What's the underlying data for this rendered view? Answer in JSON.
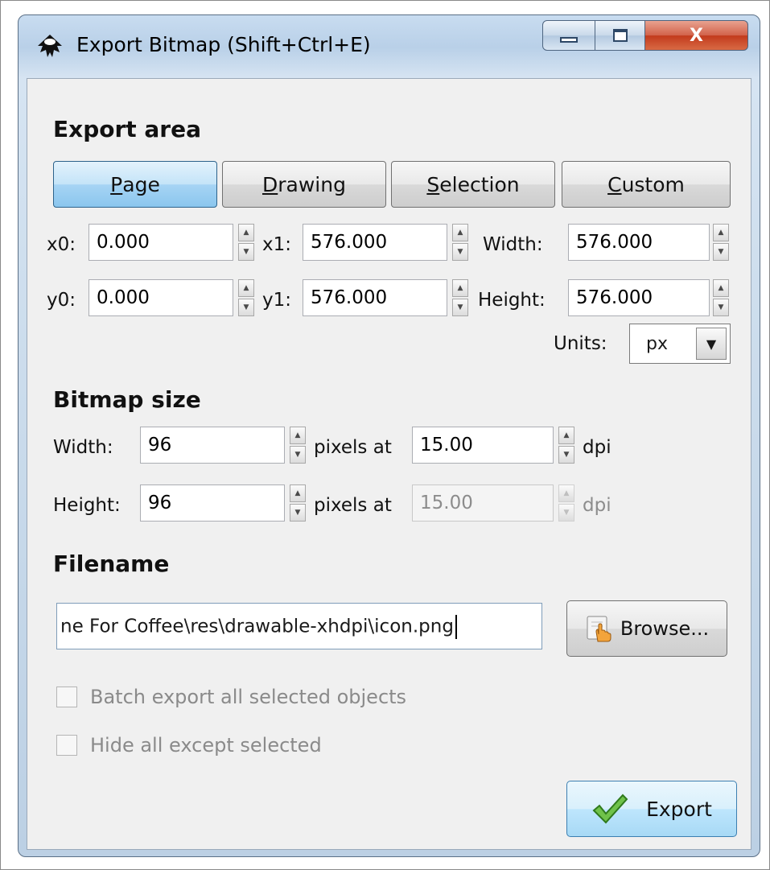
{
  "window": {
    "title": "Export Bitmap (Shift+Ctrl+E)",
    "icons": [
      "inkscape-icon",
      "minimize-icon",
      "maximize-icon",
      "close-icon"
    ],
    "close_glyph": "X"
  },
  "export_area": {
    "title": "Export area",
    "buttons": [
      {
        "label": "Page",
        "access": "P",
        "rest": "age",
        "active": true
      },
      {
        "label": "Drawing",
        "access": "D",
        "rest": "rawing",
        "active": false
      },
      {
        "label": "Selection",
        "access": "S",
        "rest": "election",
        "active": false
      },
      {
        "label": "Custom",
        "access": "C",
        "rest": "ustom",
        "active": false
      }
    ],
    "x0_label": "x0:",
    "x0": "0.000",
    "x1_label": "x1:",
    "x1": "576.000",
    "width_label": "Width:",
    "width": "576.000",
    "y0_label": "y0:",
    "y0": "0.000",
    "y1_label": "y1:",
    "y1": "576.000",
    "height_label": "Height:",
    "height": "576.000",
    "units_label": "Units:",
    "units": "px"
  },
  "bitmap_size": {
    "title": "Bitmap size",
    "width_label": "Width:",
    "width": "96",
    "height_label": "Height:",
    "height": "96",
    "pixels_at": "pixels at",
    "dpi_x": "15.00",
    "dpi_y": "15.00",
    "dpi_label": "dpi"
  },
  "filename": {
    "title": "Filename",
    "value": "ne For Coffee\\res\\drawable-xhdpi\\icon.png",
    "browse_label": "Browse..."
  },
  "options": {
    "batch_export": "Batch export all selected objects",
    "hide_all": "Hide all except selected"
  },
  "actions": {
    "export_label": "Export"
  },
  "colors": {
    "active_button": "#a6d4f4",
    "checkmark": "#4caf3a"
  }
}
